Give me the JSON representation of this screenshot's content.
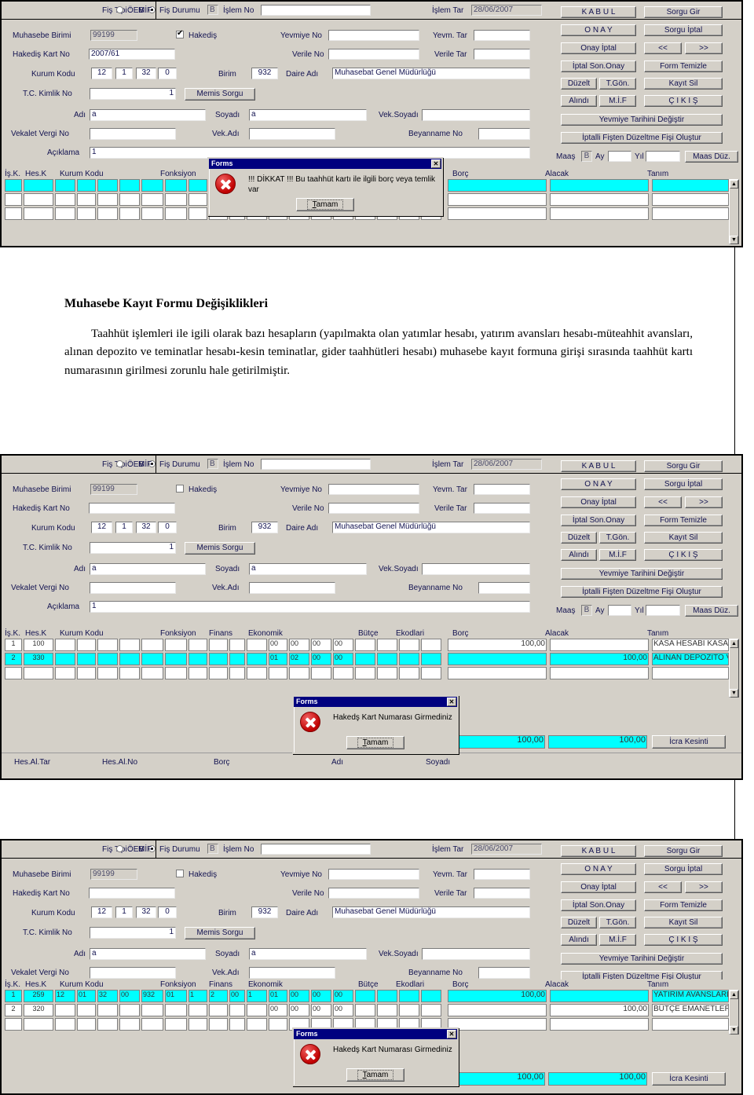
{
  "article": {
    "title": "Muhasebe Kayıt Formu Değişiklikleri",
    "paragraph": "Taahhüt işlemleri ile igili olarak bazı hesapların (yapılmakta olan yatımlar hesabı, yatırım avansları hesabı-müteahhit avansları, alınan depozito ve teminatlar hesabı-kesin teminatlar, gider taahhütleri hesabı) muhasebe kayıt formuna girişi sırasında taahhüt kartı numarasının girilmesi zorunlu hale getirilmiştir."
  },
  "form_labels": {
    "fis_tipi": "Fiş Tipi :",
    "mif": "MİF",
    "oeb": "ÖEB",
    "fis_durumu": "Fiş Durumu",
    "islem_no": "İşlem No",
    "islem_tar": "İşlem Tar",
    "muhasebe_birimi": "Muhasebe Birimi",
    "hakedis": "Hakediş",
    "yevmiye_no": "Yevmiye No",
    "yevm_tar": "Yevm. Tar",
    "hakedis_kart_no": "Hakediş Kart No",
    "verile_no": "Verile No",
    "verile_tar": "Verile Tar",
    "kurum_kodu": "Kurum Kodu",
    "birim": "Birim",
    "daire_adi": "Daire Adı",
    "tc_kimlik_no": "T.C. Kimlik No",
    "memis_sorgu": "Memis Sorgu",
    "adi": "Adı",
    "soyadi": "Soyadı",
    "vek_soyadi": "Vek.Soyadı",
    "vekalet_vergi_no": "Vekalet Vergi No",
    "vek_adi": "Vek.Adı",
    "beyanname_no": "Beyanname No",
    "aciklama": "Açıklama",
    "maas": "Maaş",
    "ay": "Ay",
    "yil": "Yıl"
  },
  "buttons": {
    "kabul": "K A B U L",
    "onay": "O N A Y",
    "onay_iptal": "Onay İptal",
    "iptal_son_onay": "İptal Son.Onay",
    "duzelt": "Düzelt",
    "t_gon": "T.Gön.",
    "alindi": "Alındı",
    "mif": "M.İ.F",
    "yevmiye_tarihini_degistir": "Yevmiye Tarihini Değiştir",
    "iptalli_fisten": "İptalli Fişten Düzeltme Fişi Oluştur",
    "maas_duz": "Maas Düz.",
    "sorgu_gir": "Sorgu Gir",
    "sorgu_iptal": "Sorgu İptal",
    "prev": "<<",
    "next": ">>",
    "form_temizle": "Form Temizle",
    "kayit_sil": "Kayıt Sil",
    "cikis": "Ç I K I Ş",
    "icra_kesinti": "İcra Kesinti"
  },
  "grid_headers": {
    "is_k": "İş.K.",
    "hes_k": "Hes.K",
    "kurum_kodu": "Kurum Kodu",
    "fonksiyon": "Fonksiyon",
    "finans": "Finans",
    "ekonomik": "Ekonomik",
    "butce": "Bütçe",
    "ekodlari": "Ekodlari",
    "borc": "Borç",
    "alacak": "Alacak",
    "tanim": "Tanım"
  },
  "footer_headers": {
    "hes_al_tar": "Hes.Al.Tar",
    "hes_al_no": "Hes.Al.No",
    "borc": "Borç",
    "adi": "Adı",
    "soyadi": "Soyadı"
  },
  "dialog_common": {
    "title": "Forms",
    "ok": "Tamam",
    "close": "✕"
  },
  "screens": [
    {
      "id": "screen-1",
      "values": {
        "fis_durumu": "B",
        "islem_no": "",
        "islem_tar": "28/06/2007",
        "muhasebe_birimi": "99199",
        "hakedis_checked": true,
        "yevmiye_no": "",
        "yevm_tar": "",
        "hakedis_kart_no": "2007/61",
        "verile_no": "",
        "verile_tar": "",
        "kurum_kodu": [
          "12",
          "1",
          "32",
          "0"
        ],
        "birim": "932",
        "daire_adi": "Muhasebat Genel Müdürlüğü",
        "tc_kimlik_no": "1",
        "adi": "a",
        "soyadi": "a",
        "vek_soyadi": "",
        "vekalet_vergi_no": "",
        "vek_adi": "",
        "beyanname_no": "",
        "aciklama": "1",
        "maas_b": "B",
        "maas_ay": "",
        "maas_yil": ""
      },
      "rows": [
        {
          "selected": true,
          "is_k": "",
          "hes_k": "",
          "kurum": [
            "",
            "",
            "",
            "",
            "",
            ""
          ],
          "fonk": [
            "",
            "",
            ""
          ],
          "finans": "",
          "ekonomik": [
            "",
            "",
            "",
            ""
          ],
          "butce": [
            "",
            ""
          ],
          "borc": "",
          "alacak": "",
          "tanim": ""
        },
        {
          "selected": false,
          "is_k": "",
          "hes_k": "",
          "kurum": [
            "",
            "",
            "",
            "",
            "",
            ""
          ],
          "fonk": [
            "",
            "",
            ""
          ],
          "finans": "",
          "ekonomik": [
            "",
            "",
            "",
            ""
          ],
          "butce": [
            "",
            ""
          ],
          "borc": "",
          "alacak": "",
          "tanim": ""
        },
        {
          "selected": false,
          "is_k": "",
          "hes_k": "",
          "kurum": [
            "",
            "",
            "",
            "",
            "",
            ""
          ],
          "fonk": [
            "",
            "",
            ""
          ],
          "finans": "",
          "ekonomik": [
            "",
            "",
            "",
            ""
          ],
          "butce": [
            "",
            ""
          ],
          "borc": "",
          "alacak": "",
          "tanim": ""
        }
      ],
      "dialog": {
        "message": "!!! DİKKAT !!!  Bu taahhüt kartı ile ilgili borç veya temlik var"
      }
    },
    {
      "id": "screen-2",
      "values": {
        "fis_durumu": "B",
        "islem_no": "",
        "islem_tar": "28/06/2007",
        "muhasebe_birimi": "99199",
        "hakedis_checked": false,
        "yevmiye_no": "",
        "yevm_tar": "",
        "hakedis_kart_no": "",
        "verile_no": "",
        "verile_tar": "",
        "kurum_kodu": [
          "12",
          "1",
          "32",
          "0"
        ],
        "birim": "932",
        "daire_adi": "Muhasebat Genel Müdürlüğü",
        "tc_kimlik_no": "1",
        "adi": "a",
        "soyadi": "a",
        "vek_soyadi": "",
        "vekalet_vergi_no": "",
        "vek_adi": "",
        "beyanname_no": "",
        "aciklama": "1",
        "maas_b": "B",
        "maas_ay": "",
        "maas_yil": ""
      },
      "rows": [
        {
          "selected": false,
          "is_k": "1",
          "hes_k": "100",
          "kurum": [
            "",
            "",
            "",
            "",
            "",
            ""
          ],
          "fonk": [
            "",
            "",
            ""
          ],
          "finans": "",
          "ekonomik": [
            "00",
            "00",
            "00",
            "00"
          ],
          "butce": [
            "",
            ""
          ],
          "borc": "100,00",
          "alacak": "",
          "tanim": "KASA HESABI KASA"
        },
        {
          "selected": true,
          "is_k": "2",
          "hes_k": "330",
          "kurum": [
            "",
            "",
            "",
            "",
            "",
            ""
          ],
          "fonk": [
            "",
            "",
            ""
          ],
          "finans": "",
          "ekonomik": [
            "01",
            "02",
            "00",
            "00"
          ],
          "butce": [
            "",
            ""
          ],
          "borc": "",
          "alacak": "100,00",
          "tanim": "ALINAN DEPOZİTO V"
        },
        {
          "selected": false,
          "is_k": "",
          "hes_k": "",
          "kurum": [
            "",
            "",
            "",
            "",
            "",
            ""
          ],
          "fonk": [
            "",
            "",
            ""
          ],
          "finans": "",
          "ekonomik": [
            "",
            "",
            "",
            ""
          ],
          "butce": [
            "",
            ""
          ],
          "borc": "",
          "alacak": "",
          "tanim": ""
        }
      ],
      "totals": {
        "borc": "100,00",
        "alacak": "100,00"
      },
      "dialog": {
        "message": "Hakedş Kart Numarası Girmediniz"
      }
    },
    {
      "id": "screen-3",
      "values": {
        "fis_durumu": "B",
        "islem_no": "",
        "islem_tar": "28/06/2007",
        "muhasebe_birimi": "99199",
        "hakedis_checked": false,
        "yevmiye_no": "",
        "yevm_tar": "",
        "hakedis_kart_no": "",
        "verile_no": "",
        "verile_tar": "",
        "kurum_kodu": [
          "12",
          "1",
          "32",
          "0"
        ],
        "birim": "932",
        "daire_adi": "Muhasebat Genel Müdürlüğü",
        "tc_kimlik_no": "1",
        "adi": "a",
        "soyadi": "a",
        "vek_soyadi": "",
        "vekalet_vergi_no": "",
        "vek_adi": "",
        "beyanname_no": "",
        "aciklama": "1",
        "maas_b": "B",
        "maas_ay": "",
        "maas_yil": ""
      },
      "rows": [
        {
          "selected": true,
          "is_k": "1",
          "hes_k": "259",
          "kurum": [
            "12",
            "01",
            "32",
            "00",
            "932",
            "01"
          ],
          "fonk": [
            "1",
            "2",
            "00"
          ],
          "finans": "1",
          "ekonomik": [
            "01",
            "00",
            "00",
            "00"
          ],
          "butce": [
            "",
            ""
          ],
          "borc": "100,00",
          "alacak": "",
          "tanim": "YATIRIM AVANSLARI"
        },
        {
          "selected": false,
          "is_k": "2",
          "hes_k": "320",
          "kurum": [
            "",
            "",
            "",
            "",
            "",
            ""
          ],
          "fonk": [
            "",
            "",
            ""
          ],
          "finans": "",
          "ekonomik": [
            "00",
            "00",
            "00",
            "00"
          ],
          "butce": [
            "",
            ""
          ],
          "borc": "",
          "alacak": "100,00",
          "tanim": "BÜTÇE EMANETLER"
        },
        {
          "selected": false,
          "is_k": "",
          "hes_k": "",
          "kurum": [
            "",
            "",
            "",
            "",
            "",
            ""
          ],
          "fonk": [
            "",
            "",
            ""
          ],
          "finans": "",
          "ekonomik": [
            "",
            "",
            "",
            ""
          ],
          "butce": [
            "",
            ""
          ],
          "borc": "",
          "alacak": "",
          "tanim": ""
        }
      ],
      "totals": {
        "borc": "100,00",
        "alacak": "100,00"
      },
      "dialog": {
        "message": "Hakedş Kart Numarası Girmediniz"
      }
    }
  ],
  "colors": {
    "selection": "#00ffff",
    "window_face": "#d4d0c8",
    "titlebar": "#00007f",
    "label_text": "#121250"
  }
}
